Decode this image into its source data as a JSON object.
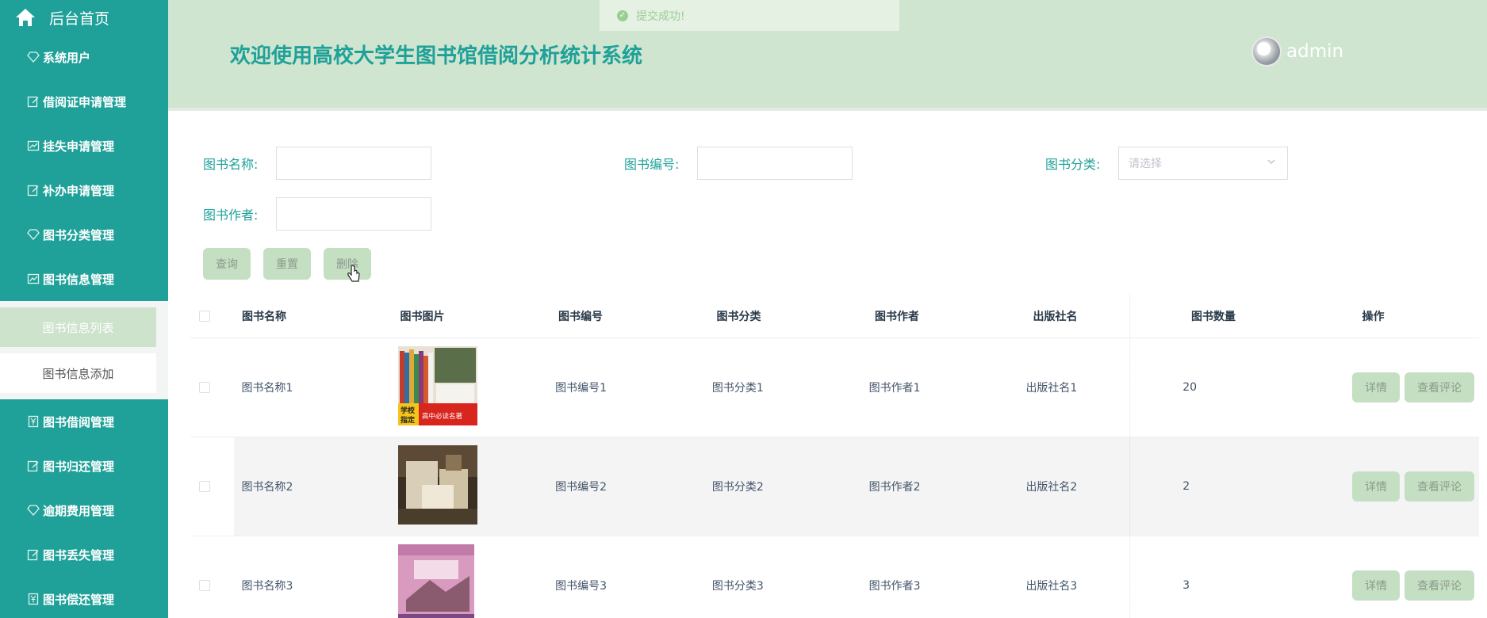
{
  "sidebar": {
    "home_label": "后台首页",
    "items_top": [
      {
        "label": "系统用户",
        "icon": "diamond-icon"
      },
      {
        "label": "借阅证申请管理",
        "icon": "edit-icon"
      },
      {
        "label": "挂失申请管理",
        "icon": "chart-icon"
      },
      {
        "label": "补办申请管理",
        "icon": "edit-icon"
      },
      {
        "label": "图书分类管理",
        "icon": "diamond-icon"
      },
      {
        "label": "图书信息管理",
        "icon": "chart-icon"
      }
    ],
    "submenu": [
      {
        "label": "图书信息列表",
        "active": true
      },
      {
        "label": "图书信息添加",
        "active": false
      }
    ],
    "items_bottom": [
      {
        "label": "图书借阅管理",
        "icon": "yen-icon"
      },
      {
        "label": "图书归还管理",
        "icon": "edit-icon"
      },
      {
        "label": "逾期费用管理",
        "icon": "diamond-icon"
      },
      {
        "label": "图书丢失管理",
        "icon": "edit-icon"
      },
      {
        "label": "图书偿还管理",
        "icon": "yen-icon"
      }
    ]
  },
  "header": {
    "title": "欢迎使用高校大学生图书馆借阅分析统计系统",
    "user_name": "admin"
  },
  "toast": {
    "message": "提交成功!"
  },
  "search": {
    "name_label": "图书名称:",
    "name_value": "",
    "number_label": "图书编号:",
    "number_value": "",
    "category_label": "图书分类:",
    "category_placeholder": "请选择",
    "author_label": "图书作者:",
    "author_value": "",
    "query_button": "查询",
    "reset_button": "重置",
    "delete_button": "删除"
  },
  "table": {
    "columns": [
      "图书名称",
      "图书图片",
      "图书编号",
      "图书分类",
      "图书作者",
      "出版社名",
      "图书数量",
      "操作"
    ],
    "rows": [
      {
        "name": "图书名称1",
        "number": "图书编号1",
        "category": "图书分类1",
        "author": "图书作者1",
        "publisher": "出版社名1",
        "quantity": "20"
      },
      {
        "name": "图书名称2",
        "number": "图书编号2",
        "category": "图书分类2",
        "author": "图书作者2",
        "publisher": "出版社名2",
        "quantity": "2"
      },
      {
        "name": "图书名称3",
        "number": "图书编号3",
        "category": "图书分类3",
        "author": "图书作者3",
        "publisher": "出版社名3",
        "quantity": "3"
      }
    ],
    "detail_button": "详情",
    "comment_button": "查看评论"
  },
  "colors": {
    "sidebar": "#1fa199",
    "header": "#cfe5d0",
    "button": "#c5dfc3",
    "accent_text": "#1fa199"
  }
}
